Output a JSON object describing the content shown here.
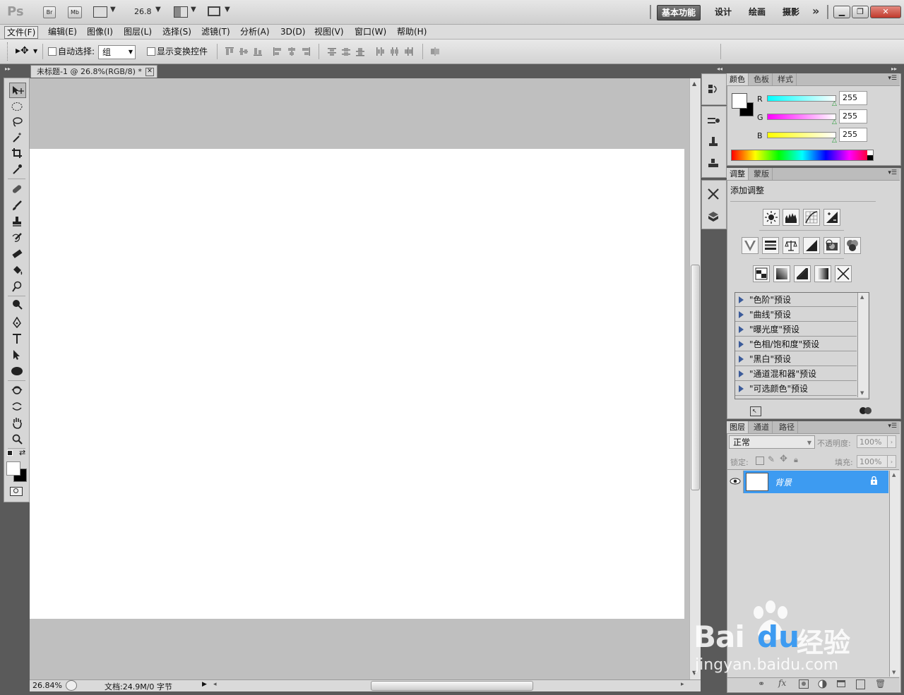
{
  "titlebar": {
    "app_logo": "Ps",
    "bridge_label": "Br",
    "minibridge_label": "Mb",
    "zoom_value": "26.8",
    "workspaces": [
      "基本功能",
      "设计",
      "绘画",
      "摄影"
    ],
    "more_label": "»"
  },
  "menu": [
    "文件(F)",
    "编辑(E)",
    "图像(I)",
    "图层(L)",
    "选择(S)",
    "滤镜(T)",
    "分析(A)",
    "3D(D)",
    "视图(V)",
    "窗口(W)",
    "帮助(H)"
  ],
  "options": {
    "auto_select_label": "自动选择:",
    "auto_select_value": "组",
    "show_transform_label": "显示变换控件"
  },
  "document": {
    "tab_title": "未标题-1 @ 26.8%(RGB/8) *",
    "zoom_status": "26.84%",
    "doc_info": "文档:24.9M/0 字节"
  },
  "color_panel": {
    "tabs": [
      "颜色",
      "色板",
      "样式"
    ],
    "r_label": "R",
    "g_label": "G",
    "b_label": "B",
    "r_value": "255",
    "g_value": "255",
    "b_value": "255"
  },
  "adjust_panel": {
    "tabs": [
      "调整",
      "蒙版"
    ],
    "title": "添加调整",
    "presets": [
      "\"色阶\"预设",
      "\"曲线\"预设",
      "\"曝光度\"预设",
      "\"色相/饱和度\"预设",
      "\"黑白\"预设",
      "\"通道混和器\"预设",
      "\"可选颜色\"预设"
    ]
  },
  "layers_panel": {
    "tabs": [
      "图层",
      "通道",
      "路径"
    ],
    "blend_mode": "正常",
    "opacity_label": "不透明度:",
    "opacity_value": "100%",
    "lock_label": "锁定:",
    "fill_label": "填充:",
    "fill_value": "100%",
    "layer_name": "背景"
  },
  "watermark": {
    "brand": "Bai",
    "brand2": "du",
    "cn": "经验",
    "url": "jingyan.baidu.com"
  },
  "colors": {
    "accent_layer": "#3d9bf1",
    "canvas_bg": "#bfbfbf",
    "app_bg": "#5a5a5a"
  }
}
